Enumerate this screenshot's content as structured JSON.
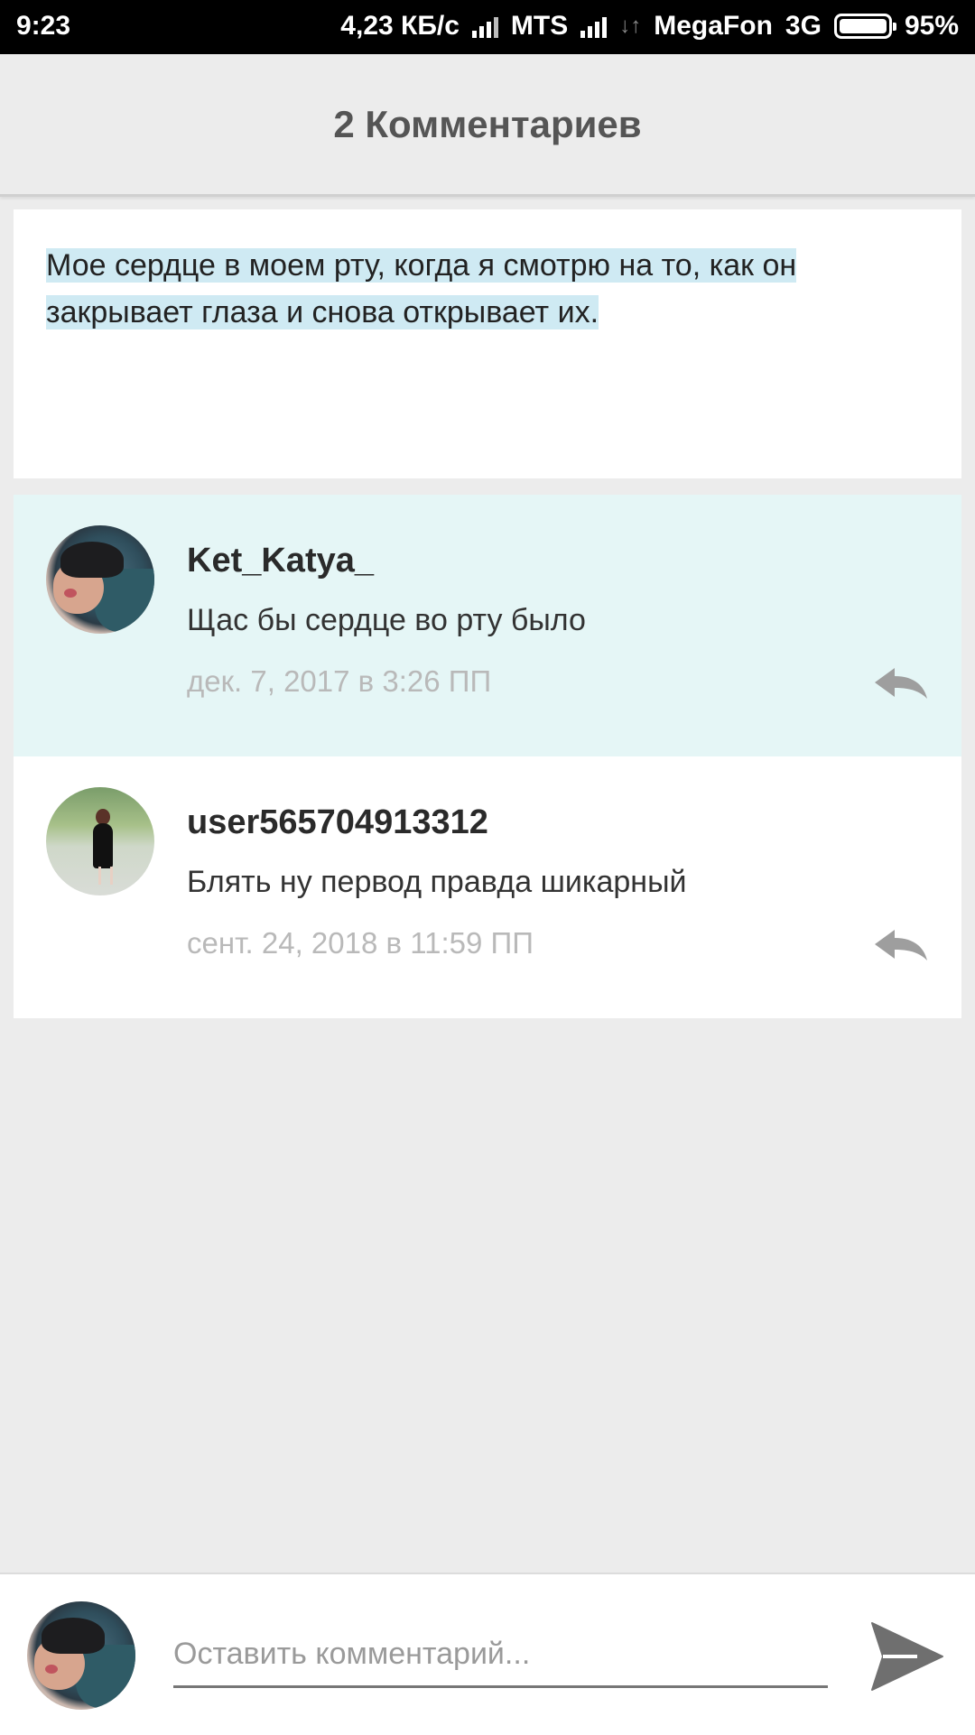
{
  "status_bar": {
    "time": "9:23",
    "speed": "4,23 КБ/с",
    "carrier1": "MTS",
    "carrier2": "MegaFon",
    "network": "3G",
    "battery": "95%"
  },
  "header": {
    "title": "2 Комментариев"
  },
  "post": {
    "text": "Мое сердце в моем рту, когда я смотрю на то, как он закрывает глаза и снова открывает их."
  },
  "comments": [
    {
      "username": "Ket_Katya_",
      "text": "Щас бы сердце во рту было",
      "timestamp": "дек. 7, 2017 в 3:26 ПП",
      "reply_icon": "reply-icon"
    },
    {
      "username": "user565704913312",
      "text": "Блять ну первод правда шикарный",
      "timestamp": "сент. 24, 2018 в 11:59 ПП",
      "reply_icon": "reply-icon"
    }
  ],
  "composer": {
    "placeholder": "Оставить комментарий...",
    "send_icon": "send-icon"
  },
  "colors": {
    "highlight": "#e5f6f6",
    "selection": "#cfeaf3",
    "background": "#ececec"
  }
}
